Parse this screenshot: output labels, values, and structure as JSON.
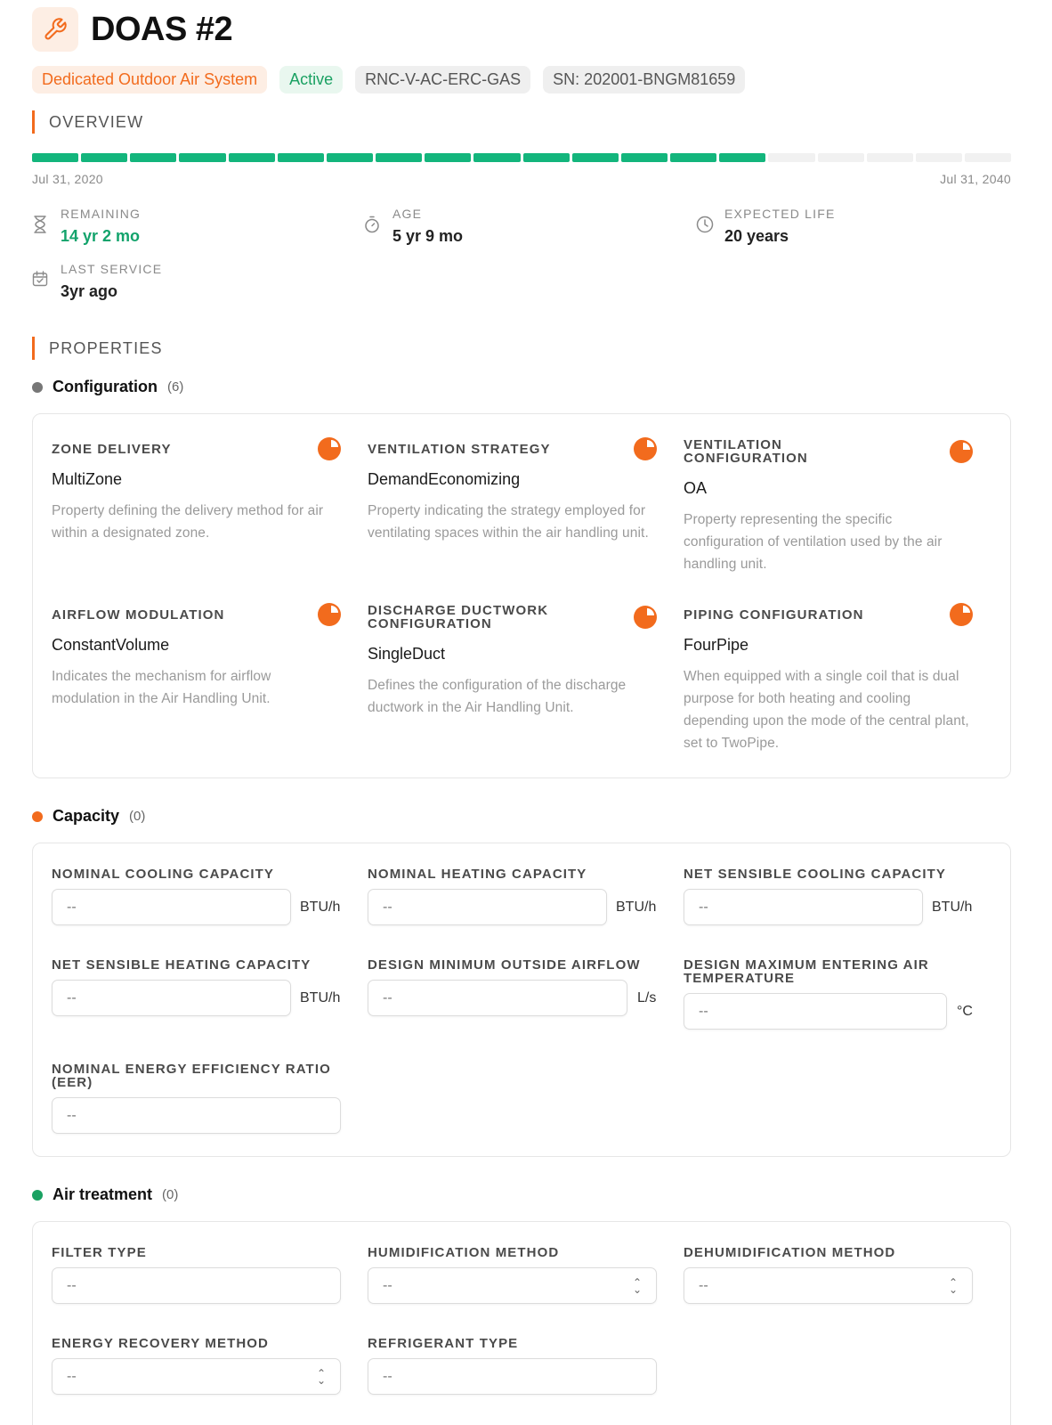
{
  "header": {
    "title": "DOAS #2",
    "icon": "wrench-icon",
    "badges": {
      "type": "Dedicated Outdoor Air System",
      "status": "Active",
      "model": "RNC-V-AC-ERC-GAS",
      "serial": "SN: 202001-BNGM81659"
    }
  },
  "overview": {
    "heading": "OVERVIEW",
    "timeline": {
      "start": "Jul 31, 2020",
      "end": "Jul 31, 2040",
      "segments_total": 20,
      "segments_elapsed": 15
    },
    "remaining": {
      "label": "REMAINING",
      "value": "14 yr 2 mo",
      "icon": "hourglass-icon"
    },
    "age": {
      "label": "AGE",
      "value": "5 yr 9 mo",
      "icon": "stopwatch-icon"
    },
    "expected_life": {
      "label": "EXPECTED LIFE",
      "value": "20 years",
      "icon": "clock-icon"
    },
    "last_service": {
      "label": "LAST SERVICE",
      "value": "3yr ago",
      "icon": "calendar-icon"
    }
  },
  "properties": {
    "heading": "PROPERTIES",
    "configuration": {
      "title": "Configuration",
      "count": "(6)",
      "color": "#777777",
      "items": [
        {
          "label": "ZONE DELIVERY",
          "value": "MultiZone",
          "desc": "Property defining the delivery method for air within a designated zone."
        },
        {
          "label": "VENTILATION STRATEGY",
          "value": "DemandEconomizing",
          "desc": "Property indicating the strategy employed for ventilating spaces within the air handling unit."
        },
        {
          "label": "VENTILATION CONFIGURATION",
          "value": "OA",
          "desc": "Property representing the specific configuration of ventilation used by the air handling unit."
        },
        {
          "label": "AIRFLOW MODULATION",
          "value": "ConstantVolume",
          "desc": "Indicates the mechanism for airflow modulation in the Air Handling Unit."
        },
        {
          "label": "DISCHARGE DUCTWORK CONFIGURATION",
          "value": "SingleDuct",
          "desc": "Defines the configuration of the discharge ductwork in the Air Handling Unit."
        },
        {
          "label": "PIPING CONFIGURATION",
          "value": "FourPipe",
          "desc": "When equipped with a single coil that is dual purpose for both heating and cooling depending upon the mode of the central plant, set to TwoPipe."
        }
      ]
    },
    "capacity": {
      "title": "Capacity",
      "count": "(0)",
      "color": "#f26b1d",
      "fields": [
        {
          "label": "NOMINAL COOLING CAPACITY",
          "value": "--",
          "unit": "BTU/h"
        },
        {
          "label": "NOMINAL HEATING CAPACITY",
          "value": "--",
          "unit": "BTU/h"
        },
        {
          "label": "NET SENSIBLE COOLING CAPACITY",
          "value": "--",
          "unit": "BTU/h"
        },
        {
          "label": "NET SENSIBLE HEATING CAPACITY",
          "value": "--",
          "unit": "BTU/h"
        },
        {
          "label": "DESIGN MINIMUM OUTSIDE AIRFLOW",
          "value": "--",
          "unit": "L/s"
        },
        {
          "label": "DESIGN MAXIMUM ENTERING AIR TEMPERATURE",
          "value": "--",
          "unit": "°C"
        },
        {
          "label": "NOMINAL ENERGY EFFICIENCY RATIO (EER)",
          "value": "--",
          "unit": ""
        }
      ]
    },
    "air_treatment": {
      "title": "Air treatment",
      "count": "(0)",
      "color": "#1aa162",
      "fields": [
        {
          "label": "FILTER TYPE",
          "value": "--"
        },
        {
          "label": "HUMIDIFICATION METHOD",
          "value": "--"
        },
        {
          "label": "DEHUMIDIFICATION METHOD",
          "value": "--"
        },
        {
          "label": "ENERGY RECOVERY METHOD",
          "value": "--"
        },
        {
          "label": "REFRIGERANT TYPE",
          "value": "--"
        }
      ]
    }
  },
  "colors": {
    "accent": "#f26b1d",
    "progress": "#13b57c",
    "remaining": "#13a36c"
  }
}
